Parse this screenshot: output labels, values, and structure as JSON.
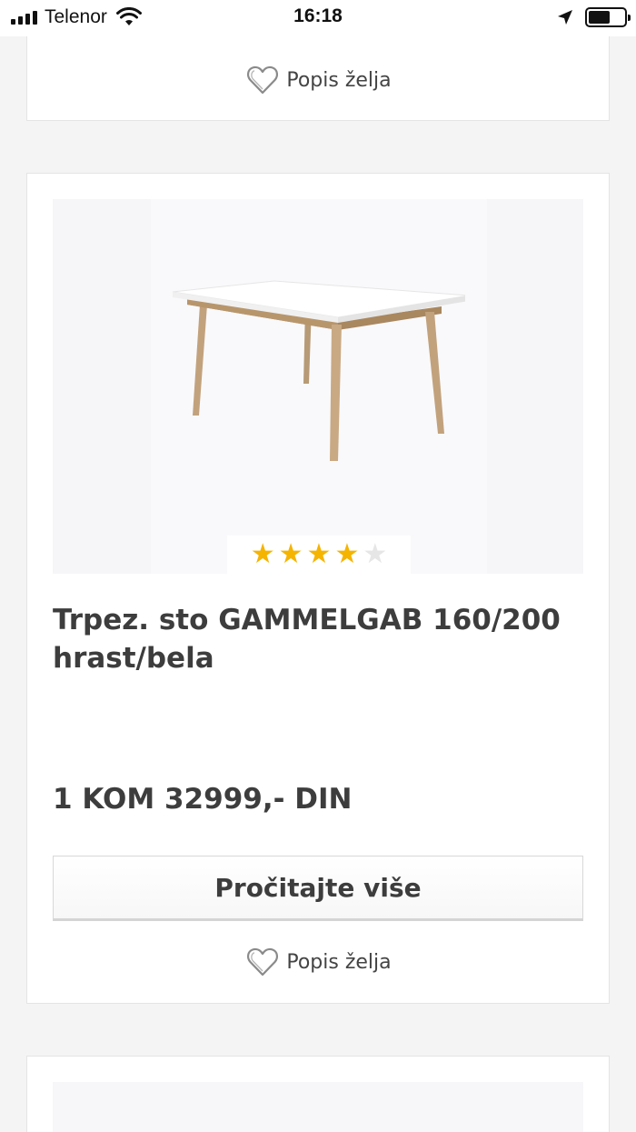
{
  "status_bar": {
    "carrier": "Telenor",
    "time": "16:18",
    "battery_level": 0.6
  },
  "previous_card": {
    "wishlist_label": "Popis želja",
    "wishlist_icon": "heart-outline-icon"
  },
  "product": {
    "title": "Trpez. sto GAMMELGAB 160/200 hrast/bela",
    "rating": {
      "value": 4,
      "max": 5,
      "star_color": "#f5b400",
      "empty_star_color": "#e6e6e6"
    },
    "price": "1 KOM 32999,- DIN",
    "read_more_label": "Pročitajte više",
    "wishlist_label": "Popis želja",
    "wishlist_icon": "heart-outline-icon",
    "image_icon": "dining-table-image"
  }
}
